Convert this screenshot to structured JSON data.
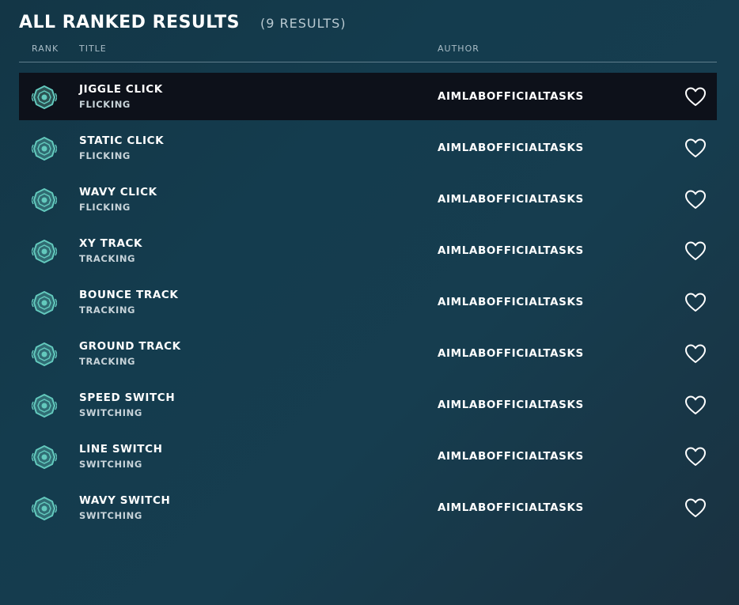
{
  "header": {
    "title": "ALL RANKED RESULTS",
    "count": "(9 RESULTS)"
  },
  "columns": {
    "rank": "RANK",
    "title": "TITLE",
    "author": "AUTHOR"
  },
  "icons": {
    "rank": "rank-badge-icon",
    "favorite": "heart-icon"
  },
  "colors": {
    "rank_badge": "#63c9bd",
    "selected_row": "#0d111a"
  },
  "results": [
    {
      "title": "JIGGLE CLICK",
      "category": "FLICKING",
      "author": "AIMLABOFFICIALTASKS",
      "selected": true
    },
    {
      "title": "STATIC CLICK",
      "category": "FLICKING",
      "author": "AIMLABOFFICIALTASKS",
      "selected": false
    },
    {
      "title": "WAVY CLICK",
      "category": "FLICKING",
      "author": "AIMLABOFFICIALTASKS",
      "selected": false
    },
    {
      "title": "XY TRACK",
      "category": "TRACKING",
      "author": "AIMLABOFFICIALTASKS",
      "selected": false
    },
    {
      "title": "BOUNCE TRACK",
      "category": "TRACKING",
      "author": "AIMLABOFFICIALTASKS",
      "selected": false
    },
    {
      "title": "GROUND TRACK",
      "category": "TRACKING",
      "author": "AIMLABOFFICIALTASKS",
      "selected": false
    },
    {
      "title": "SPEED SWITCH",
      "category": "SWITCHING",
      "author": "AIMLABOFFICIALTASKS",
      "selected": false
    },
    {
      "title": "LINE SWITCH",
      "category": "SWITCHING",
      "author": "AIMLABOFFICIALTASKS",
      "selected": false
    },
    {
      "title": "WAVY SWITCH",
      "category": "SWITCHING",
      "author": "AIMLABOFFICIALTASKS",
      "selected": false
    }
  ]
}
